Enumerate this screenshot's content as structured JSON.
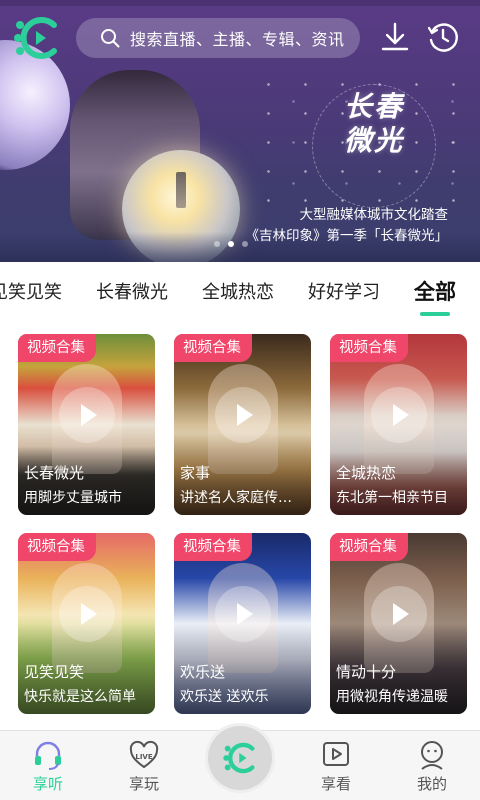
{
  "header": {
    "logo_icon": "app-logo-icon",
    "search_placeholder": "搜索直播、主播、专辑、资讯",
    "download_icon": "download-icon",
    "history_icon": "history-clock-icon"
  },
  "banner": {
    "calligraphy": [
      "长春",
      "微光"
    ],
    "caption_line1": "大型融媒体城市文化踏查",
    "caption_line2": "《吉林印象》第一季「长春微光」",
    "slide_count": 3,
    "active_slide": 2
  },
  "tabs": [
    {
      "label": "见笑见笑",
      "active": false
    },
    {
      "label": "长春微光",
      "active": false
    },
    {
      "label": "全城热恋",
      "active": false
    },
    {
      "label": "好好学习",
      "active": false
    },
    {
      "label": "全部",
      "active": true
    }
  ],
  "cards": [
    {
      "badge": "视频合集",
      "title": "长春微光",
      "desc": "用脚步丈量城市"
    },
    {
      "badge": "视频合集",
      "title": "家事",
      "desc": "讲述名人家庭传…"
    },
    {
      "badge": "视频合集",
      "title": "全城热恋",
      "desc": "东北第一相亲节目"
    },
    {
      "badge": "视频合集",
      "title": "见笑见笑",
      "desc": "快乐就是这么简单"
    },
    {
      "badge": "视频合集",
      "title": "欢乐送",
      "desc": "欢乐送 送欢乐"
    },
    {
      "badge": "视频合集",
      "title": "情动十分",
      "desc": "用微视角传递温暖"
    }
  ],
  "bottom_nav": [
    {
      "label": "享听",
      "icon": "headset-icon",
      "active": true
    },
    {
      "label": "享玩",
      "icon": "heart-live-icon",
      "active": false
    },
    {
      "label": "",
      "icon": "app-logo-icon",
      "active": false
    },
    {
      "label": "享看",
      "icon": "video-play-icon",
      "active": false
    },
    {
      "label": "我的",
      "icon": "profile-icon",
      "active": false
    }
  ],
  "colors": {
    "accent": "#2ccf9a",
    "badge": "#f0466a",
    "banner_bg": "#4b3a78"
  }
}
